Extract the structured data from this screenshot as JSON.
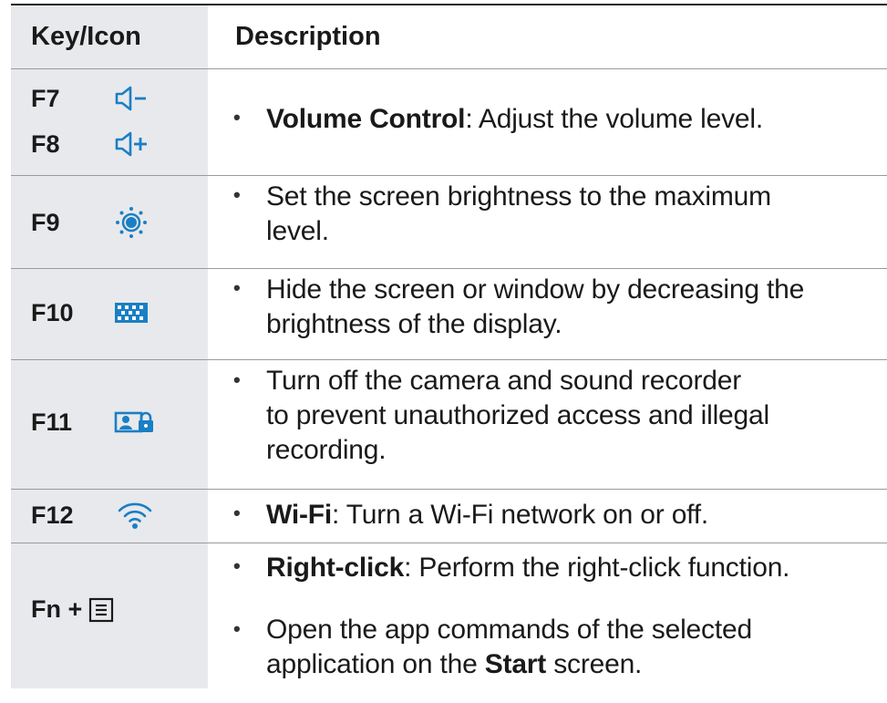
{
  "header": {
    "key_label": "Key/Icon",
    "description_label": "Description"
  },
  "colors": {
    "accent": "#1a7fc4",
    "key_column_bg": "#e8e9ec"
  },
  "rows": [
    {
      "keys": [
        {
          "key": "F7",
          "icon": "volume-down-icon"
        },
        {
          "key": "F8",
          "icon": "volume-up-icon"
        }
      ],
      "items": [
        {
          "bold": "Volume Control",
          "text": ": Adjust the volume level."
        }
      ]
    },
    {
      "keys": [
        {
          "key": "F9",
          "icon": "brightness-up-icon"
        }
      ],
      "items": [
        {
          "text_line1": "Set the screen brightness to the maximum",
          "text_line2": "level."
        }
      ]
    },
    {
      "keys": [
        {
          "key": "F10",
          "icon": "screen-off-icon"
        }
      ],
      "items": [
        {
          "text_line1": "Hide the screen or window by decreasing the",
          "text_line2": "brightness of the display."
        }
      ]
    },
    {
      "keys": [
        {
          "key": "F11",
          "icon": "camera-lock-icon"
        }
      ],
      "items": [
        {
          "text_line1": "Turn off the camera and sound recorder",
          "text_line2": "to prevent unauthorized access and illegal",
          "text_line3": "recording."
        }
      ]
    },
    {
      "keys": [
        {
          "key": "F12",
          "icon": "wifi-icon"
        }
      ],
      "items": [
        {
          "bold": "Wi-Fi",
          "text": ": Turn a Wi-Fi network on or off."
        }
      ]
    },
    {
      "keys": [
        {
          "key": "Fn +",
          "icon": "menu-icon"
        }
      ],
      "items": [
        {
          "bold": "Right-click",
          "text": ": Perform the right-click function."
        },
        {
          "text_line1": "Open the app commands of the selected",
          "text_pre": "application on the ",
          "bold": "Start",
          "text_post": " screen."
        }
      ]
    }
  ]
}
